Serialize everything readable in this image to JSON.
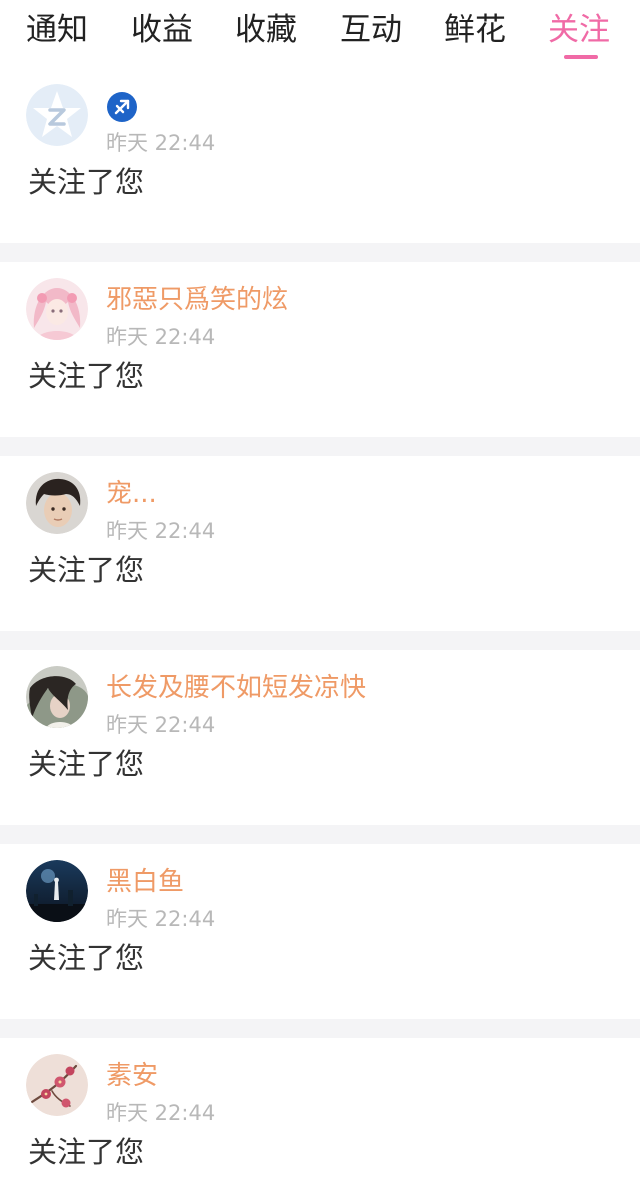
{
  "tabs": [
    {
      "label": "通知",
      "active": false
    },
    {
      "label": "收益",
      "active": false
    },
    {
      "label": "收藏",
      "active": false
    },
    {
      "label": "互动",
      "active": false
    },
    {
      "label": "鲜花",
      "active": false
    },
    {
      "label": "关注",
      "active": true
    }
  ],
  "colors": {
    "accent": "#f06aa6",
    "username": "#ef9a66",
    "timestamp": "#b8b8b8",
    "badge": "#1e64c8"
  },
  "notifications": [
    {
      "username": "",
      "badge_icon": "sagittarius-icon",
      "time": "昨天 22:44",
      "action": "关注了您",
      "avatar": "default-avatar"
    },
    {
      "username": "邪惡只爲笑的炫",
      "time": "昨天 22:44",
      "action": "关注了您",
      "avatar": "anime-girl-avatar"
    },
    {
      "username": "宠...",
      "time": "昨天 22:44",
      "action": "关注了您",
      "avatar": "man-portrait-avatar"
    },
    {
      "username": "长发及腰不如短发凉快",
      "time": "昨天 22:44",
      "action": "关注了您",
      "avatar": "long-hair-girl-avatar"
    },
    {
      "username": "黑白鱼",
      "time": "昨天 22:44",
      "action": "关注了您",
      "avatar": "night-scene-avatar"
    },
    {
      "username": "素安",
      "time": "昨天 22:44",
      "action": "关注了您",
      "avatar": "plum-blossom-avatar"
    }
  ]
}
